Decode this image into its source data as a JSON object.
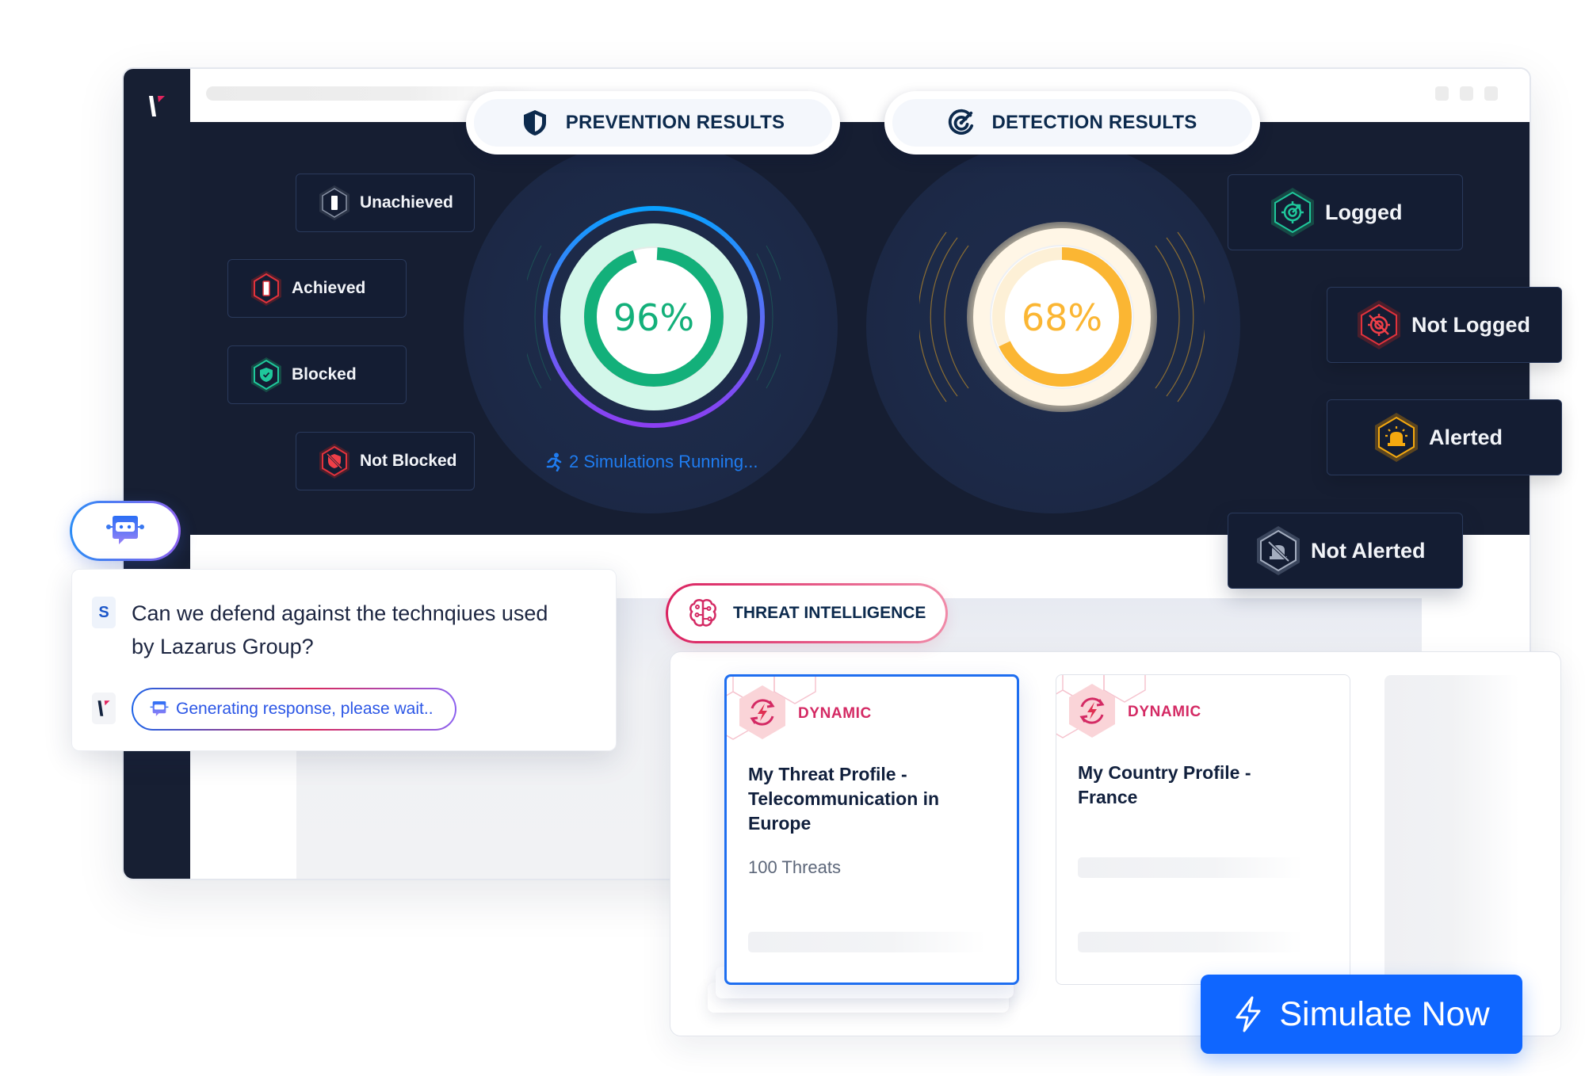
{
  "app": {
    "logo": "vectra-logo"
  },
  "sections": {
    "prevention": {
      "label": "PREVENTION RESULTS",
      "icon": "shield-icon"
    },
    "detection": {
      "label": "DETECTION RESULTS",
      "icon": "target-radar-icon"
    }
  },
  "prevention": {
    "value": 96,
    "value_label": "96%",
    "color": "#13b07a",
    "running_text": "2 Simulations Running..."
  },
  "detection": {
    "value": 68,
    "value_label": "68%",
    "color": "#fbb633"
  },
  "prevention_statuses": [
    {
      "label": "Unachieved",
      "icon": "unachieved-hex-icon",
      "color": "#5b6478"
    },
    {
      "label": "Achieved",
      "icon": "achieved-hex-icon",
      "color": "#e1323c"
    },
    {
      "label": "Blocked",
      "icon": "shield-check-hex-icon",
      "color": "#1fc79b"
    },
    {
      "label": "Not Blocked",
      "icon": "shield-off-hex-icon",
      "color": "#e1323c"
    }
  ],
  "detection_statuses": [
    {
      "label": "Logged",
      "icon": "target-hex-icon",
      "color": "#1fc79b"
    },
    {
      "label": "Not Logged",
      "icon": "target-off-hex-icon",
      "color": "#e1323c"
    },
    {
      "label": "Alerted",
      "icon": "siren-hex-icon",
      "color": "#f5a90f"
    },
    {
      "label": "Not Alerted",
      "icon": "siren-off-hex-icon",
      "color": "#8e99ae"
    }
  ],
  "chat": {
    "user_initial": "S",
    "question": "Can we defend against the technqiues used by Lazarus Group?",
    "status": "Generating response, please wait.."
  },
  "threat_intelligence": {
    "label": "THREAT INTELLIGENCE",
    "cards": [
      {
        "badge": "DYNAMIC",
        "title": "My Threat Profile - Telecommunication in Europe",
        "count": "100 Threats",
        "selected": true
      },
      {
        "badge": "DYNAMIC",
        "title": "My Country Profile - France",
        "count": "",
        "selected": false
      }
    ]
  },
  "actions": {
    "simulate": "Simulate Now"
  }
}
